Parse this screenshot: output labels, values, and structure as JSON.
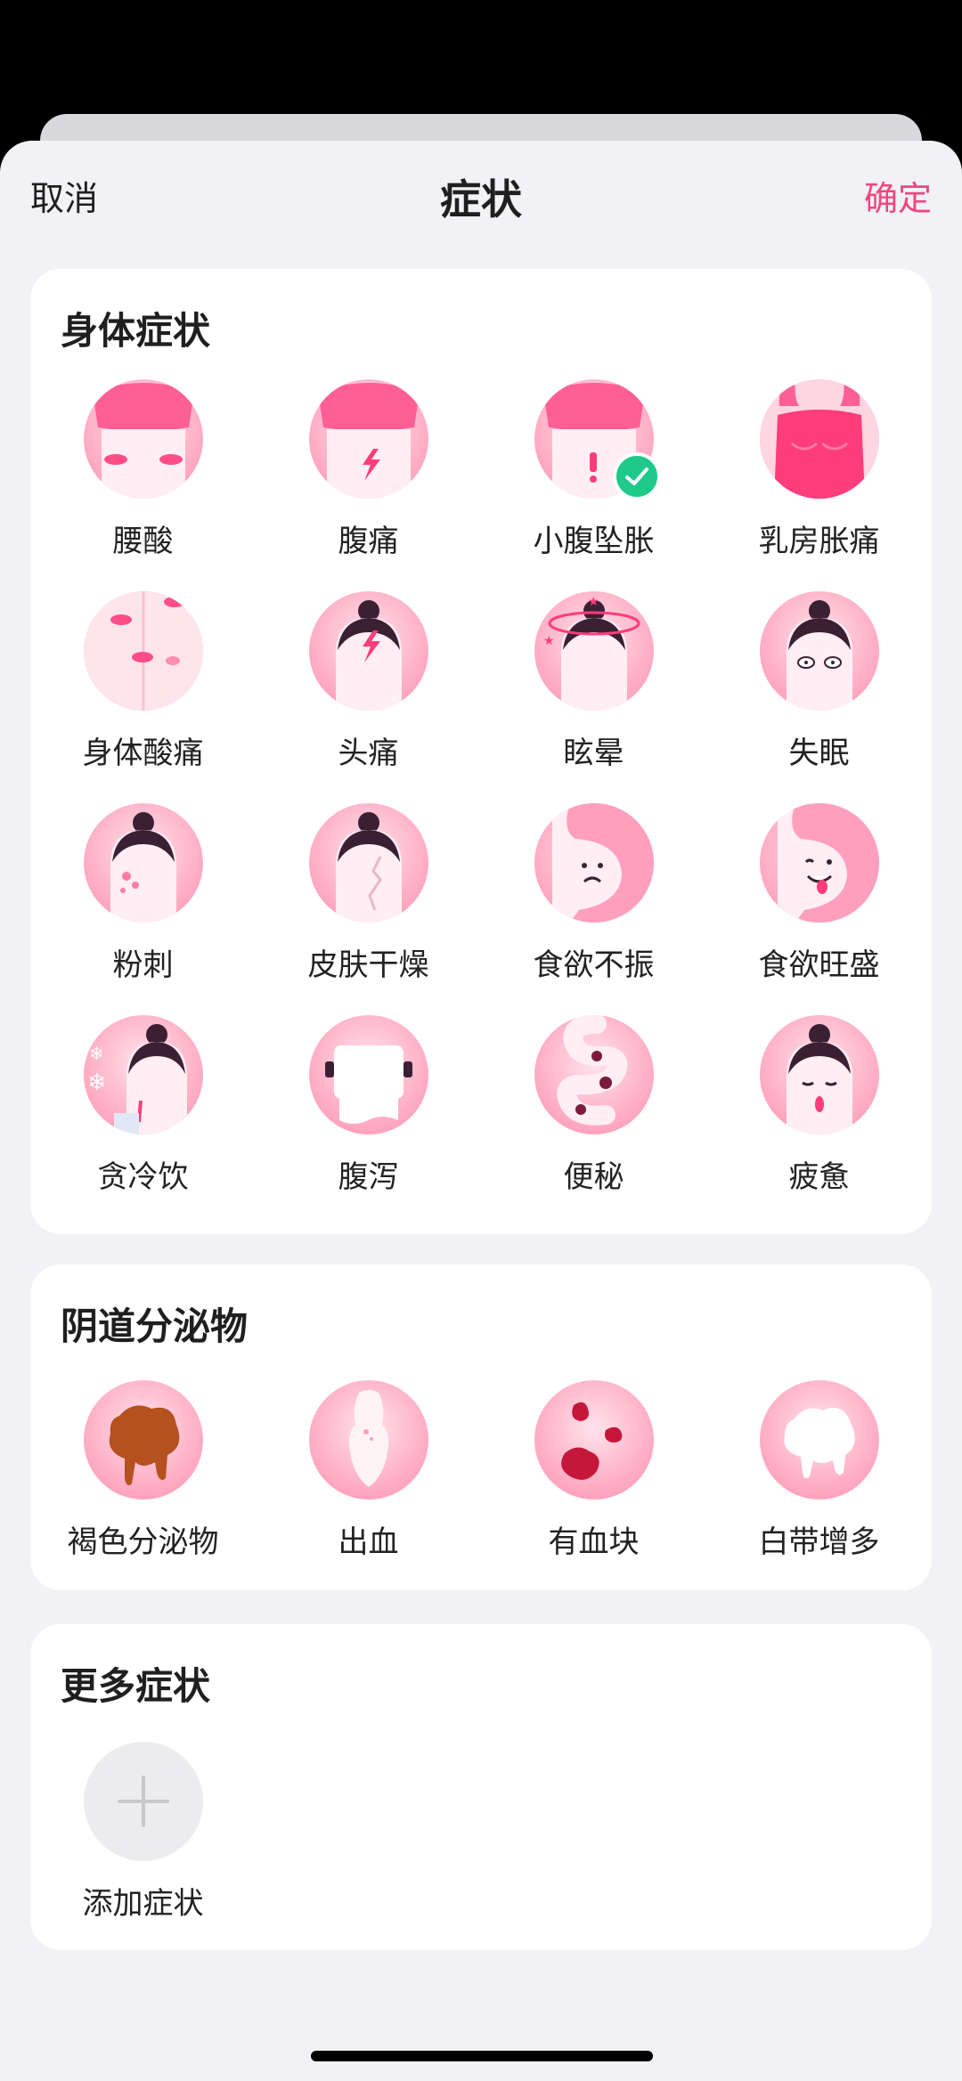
{
  "nav": {
    "cancel": "取消",
    "title": "症状",
    "confirm": "确定"
  },
  "body_symptoms": {
    "title": "身体症状",
    "items": [
      {
        "label": "腰酸",
        "icon": "backache-icon",
        "selected": false
      },
      {
        "label": "腹痛",
        "icon": "abdominal-pain-icon",
        "selected": false
      },
      {
        "label": "小腹坠胀",
        "icon": "lower-abdomen-bloating-icon",
        "selected": true
      },
      {
        "label": "乳房胀痛",
        "icon": "breast-pain-icon",
        "selected": false
      },
      {
        "label": "身体酸痛",
        "icon": "body-ache-icon",
        "selected": false
      },
      {
        "label": "头痛",
        "icon": "headache-icon",
        "selected": false
      },
      {
        "label": "眩晕",
        "icon": "dizziness-icon",
        "selected": false
      },
      {
        "label": "失眠",
        "icon": "insomnia-icon",
        "selected": false
      },
      {
        "label": "粉刺",
        "icon": "acne-icon",
        "selected": false
      },
      {
        "label": "皮肤干燥",
        "icon": "dry-skin-icon",
        "selected": false
      },
      {
        "label": "食欲不振",
        "icon": "poor-appetite-icon",
        "selected": false
      },
      {
        "label": "食欲旺盛",
        "icon": "strong-appetite-icon",
        "selected": false
      },
      {
        "label": "贪冷饮",
        "icon": "cold-drink-icon",
        "selected": false
      },
      {
        "label": "腹泻",
        "icon": "diarrhea-icon",
        "selected": false
      },
      {
        "label": "便秘",
        "icon": "constipation-icon",
        "selected": false
      },
      {
        "label": "疲惫",
        "icon": "fatigue-icon",
        "selected": false
      }
    ]
  },
  "discharge": {
    "title": "阴道分泌物",
    "items": [
      {
        "label": "褐色分泌物",
        "icon": "brown-discharge-icon"
      },
      {
        "label": "出血",
        "icon": "bleeding-icon"
      },
      {
        "label": "有血块",
        "icon": "blood-clot-icon"
      },
      {
        "label": "白带增多",
        "icon": "white-discharge-icon"
      }
    ]
  },
  "more": {
    "title": "更多症状",
    "add_label": "添加症状"
  },
  "colors": {
    "accent": "#f0467d",
    "check": "#1fc98a",
    "circle": "#ffb3c9"
  }
}
